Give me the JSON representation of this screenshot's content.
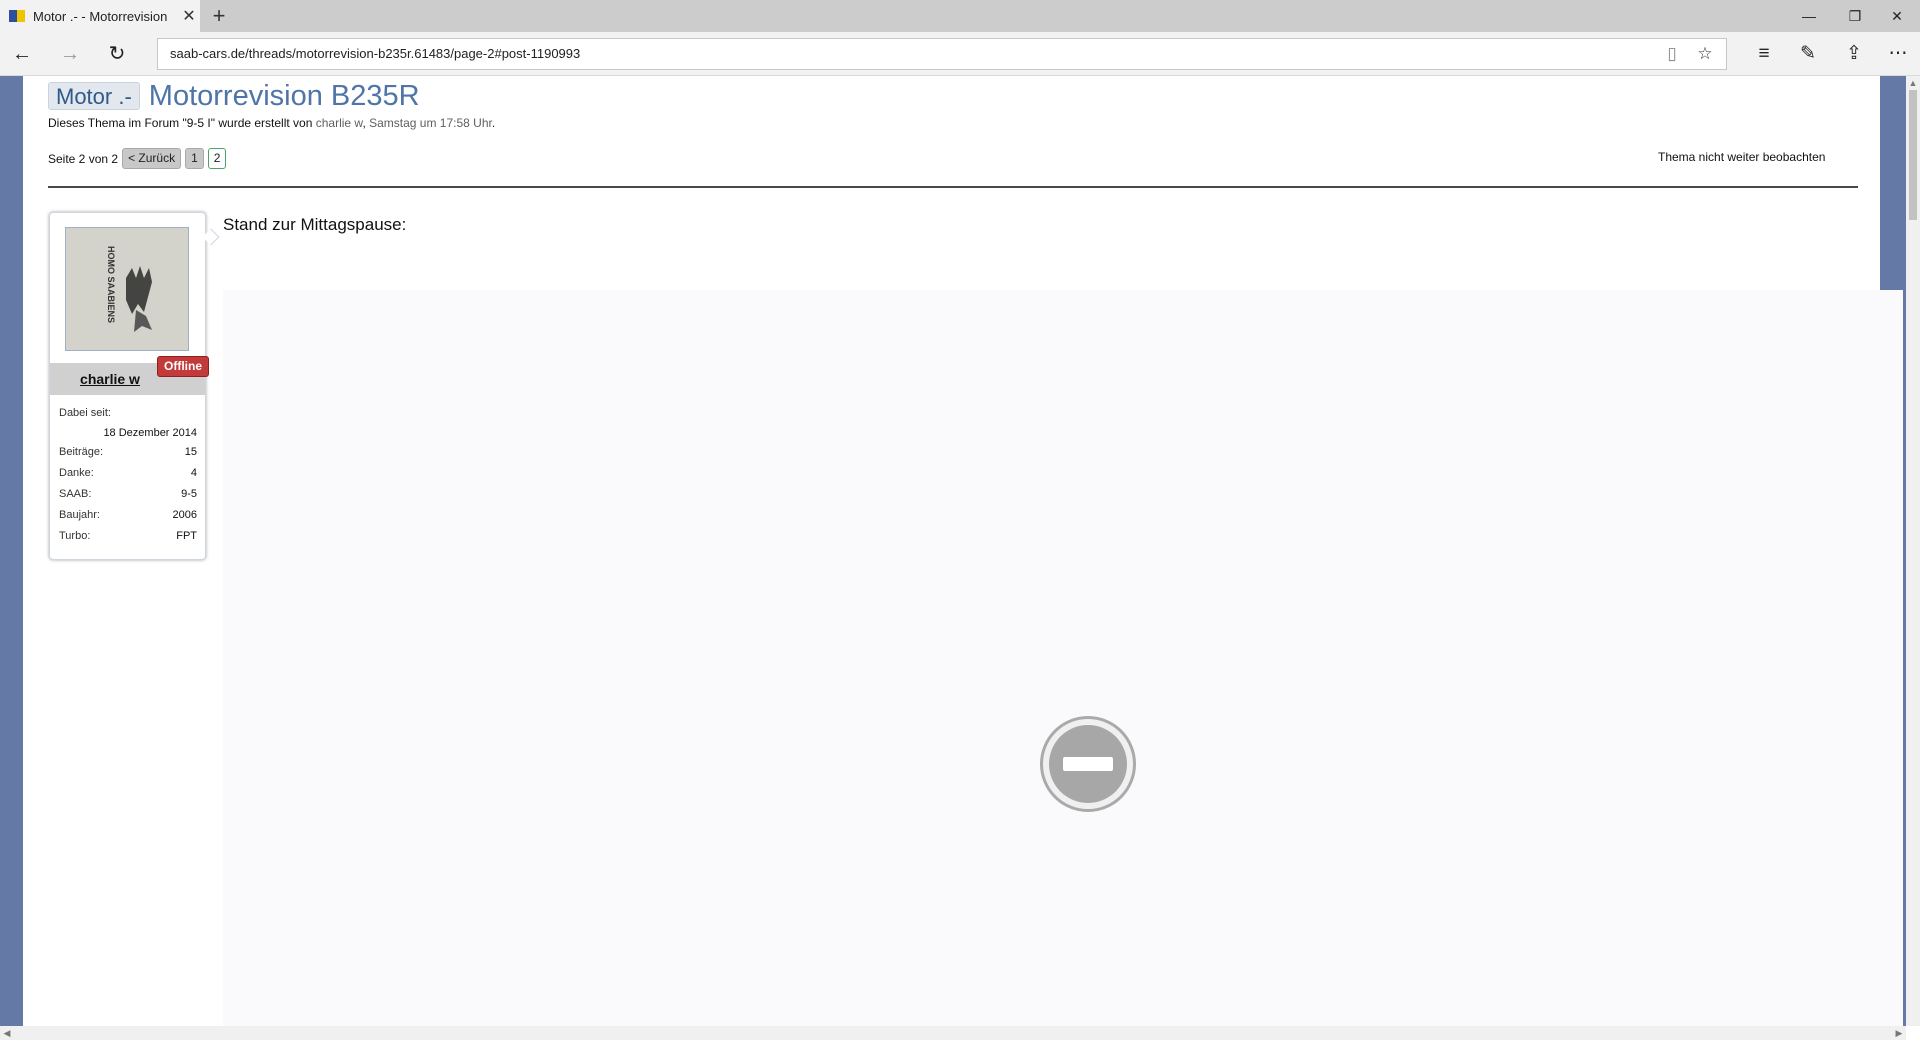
{
  "browser": {
    "tab_title": "Motor .- - Motorrevision",
    "url": "saab-cars.de/threads/motorrevision-b235r.61483/page-2#post-1190993"
  },
  "thread": {
    "prefix": "Motor .-",
    "title": "Motorrevision B235R",
    "meta_before_forum": "Dieses Thema im Forum \"",
    "forum": "9-5 I",
    "meta_after_forum": "\" wurde erstellt von ",
    "author": "charlie w",
    "meta_sep": ", ",
    "date": "Samstag um 17:58 Uhr",
    "meta_end": "."
  },
  "pagination": {
    "label": "Seite 2 von 2",
    "back_label": "< Zurück",
    "pages": [
      "1",
      "2"
    ],
    "current_page": "2",
    "watch_label": "Thema nicht weiter beobachten"
  },
  "user": {
    "name": "charlie w",
    "status": "Offline",
    "since_label": "Dabei seit:",
    "since_value": "18 Dezember 2014",
    "stats": [
      {
        "label": "Beiträge:",
        "value": "15"
      },
      {
        "label": "Danke:",
        "value": "4"
      },
      {
        "label": "SAAB:",
        "value": "9-5"
      },
      {
        "label": "Baujahr:",
        "value": "2006"
      },
      {
        "label": "Turbo:",
        "value": "FPT"
      }
    ],
    "avatar_text": "HOMO SAABIENS"
  },
  "post": {
    "text": "Stand zur Mittagspause:"
  },
  "colors": {
    "side_accent": "#6579a6",
    "title": "#4f75a8",
    "offline_badge": "#c23a3a"
  }
}
